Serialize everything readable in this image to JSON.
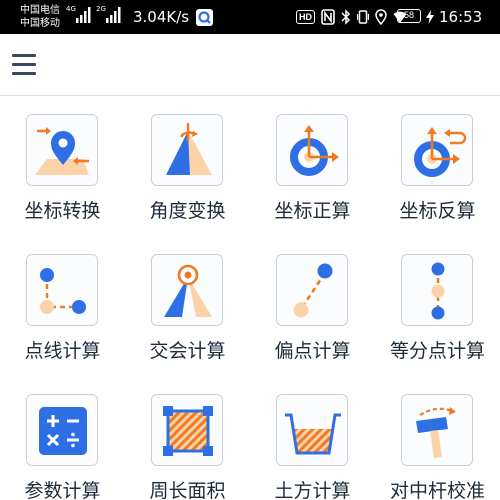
{
  "status_bar": {
    "carrier_1": "中国电信",
    "carrier_2": "中国移动",
    "signal_1_tag": "4G",
    "signal_2_tag": "2G",
    "network_speed": "3.04K/s",
    "badge": "HD",
    "battery_level": "58",
    "time": "16:53"
  },
  "app_bar": {
    "menu_icon": "hamburger-menu-icon"
  },
  "tools": [
    {
      "label": "坐标转换",
      "icon": "coordinate-convert-icon"
    },
    {
      "label": "角度变换",
      "icon": "angle-transform-icon"
    },
    {
      "label": "坐标正算",
      "icon": "coordinate-forward-icon"
    },
    {
      "label": "坐标反算",
      "icon": "coordinate-inverse-icon"
    },
    {
      "label": "点线计算",
      "icon": "point-line-icon"
    },
    {
      "label": "交会计算",
      "icon": "intersection-icon"
    },
    {
      "label": "偏点计算",
      "icon": "offset-point-icon"
    },
    {
      "label": "等分点计算",
      "icon": "equal-division-icon"
    },
    {
      "label": "参数计算",
      "icon": "calculator-icon"
    },
    {
      "label": "周长面积",
      "icon": "perimeter-area-icon"
    },
    {
      "label": "土方计算",
      "icon": "earthwork-icon"
    },
    {
      "label": "对中杆校准",
      "icon": "pole-calibration-icon"
    }
  ],
  "colors": {
    "blue": "#2f6fe6",
    "orange": "#f07a22",
    "peach": "#fcd3a8",
    "light_blue": "#cfe0fb"
  }
}
